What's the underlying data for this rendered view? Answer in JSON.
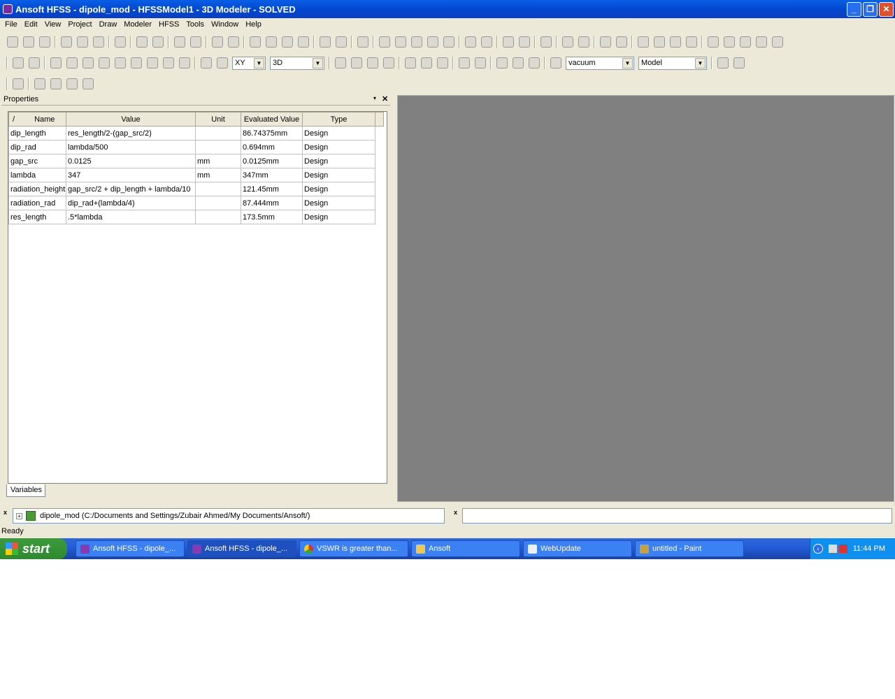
{
  "window": {
    "title": "Ansoft HFSS - dipole_mod - HFSSModel1 - 3D Modeler - SOLVED"
  },
  "menu": [
    "File",
    "Edit",
    "View",
    "Project",
    "Draw",
    "Modeler",
    "HFSS",
    "Tools",
    "Window",
    "Help"
  ],
  "toolbar": {
    "plane": "XY",
    "view": "3D",
    "material": "vacuum",
    "mode": "Model"
  },
  "properties": {
    "title": "Properties",
    "tab": "Variables",
    "columns": [
      "/",
      "Name",
      "Value",
      "Unit",
      "Evaluated Value",
      "Type"
    ],
    "rows": [
      {
        "name": "dip_length",
        "value": "res_length/2-(gap_src/2)",
        "unit": "",
        "evaluated": "86.74375mm",
        "type": "Design"
      },
      {
        "name": "dip_rad",
        "value": "lambda/500",
        "unit": "",
        "evaluated": "0.694mm",
        "type": "Design"
      },
      {
        "name": "gap_src",
        "value": "0.0125",
        "unit": "mm",
        "evaluated": "0.0125mm",
        "type": "Design"
      },
      {
        "name": "lambda",
        "value": "347",
        "unit": "mm",
        "evaluated": "347mm",
        "type": "Design"
      },
      {
        "name": "radiation_height",
        "value": "gap_src/2 + dip_length + lambda/10",
        "unit": "",
        "evaluated": "121.45mm",
        "type": "Design"
      },
      {
        "name": "radiation_rad",
        "value": "dip_rad+(lambda/4)",
        "unit": "",
        "evaluated": "87.444mm",
        "type": "Design"
      },
      {
        "name": "res_length",
        "value": ".5*lambda",
        "unit": "",
        "evaluated": "173.5mm",
        "type": "Design"
      }
    ]
  },
  "project_tree": {
    "item": "dipole_mod (C:/Documents and Settings/Zubair Ahmed/My Documents/Ansoft/)"
  },
  "status": "Ready",
  "taskbar": {
    "start": "start",
    "tasks": [
      "Ansoft HFSS - dipole_...",
      "Ansoft HFSS - dipole_...",
      "VSWR is greater than...",
      "Ansoft",
      "WebUpdate",
      "untitled - Paint"
    ],
    "clock": "11:44 PM"
  }
}
